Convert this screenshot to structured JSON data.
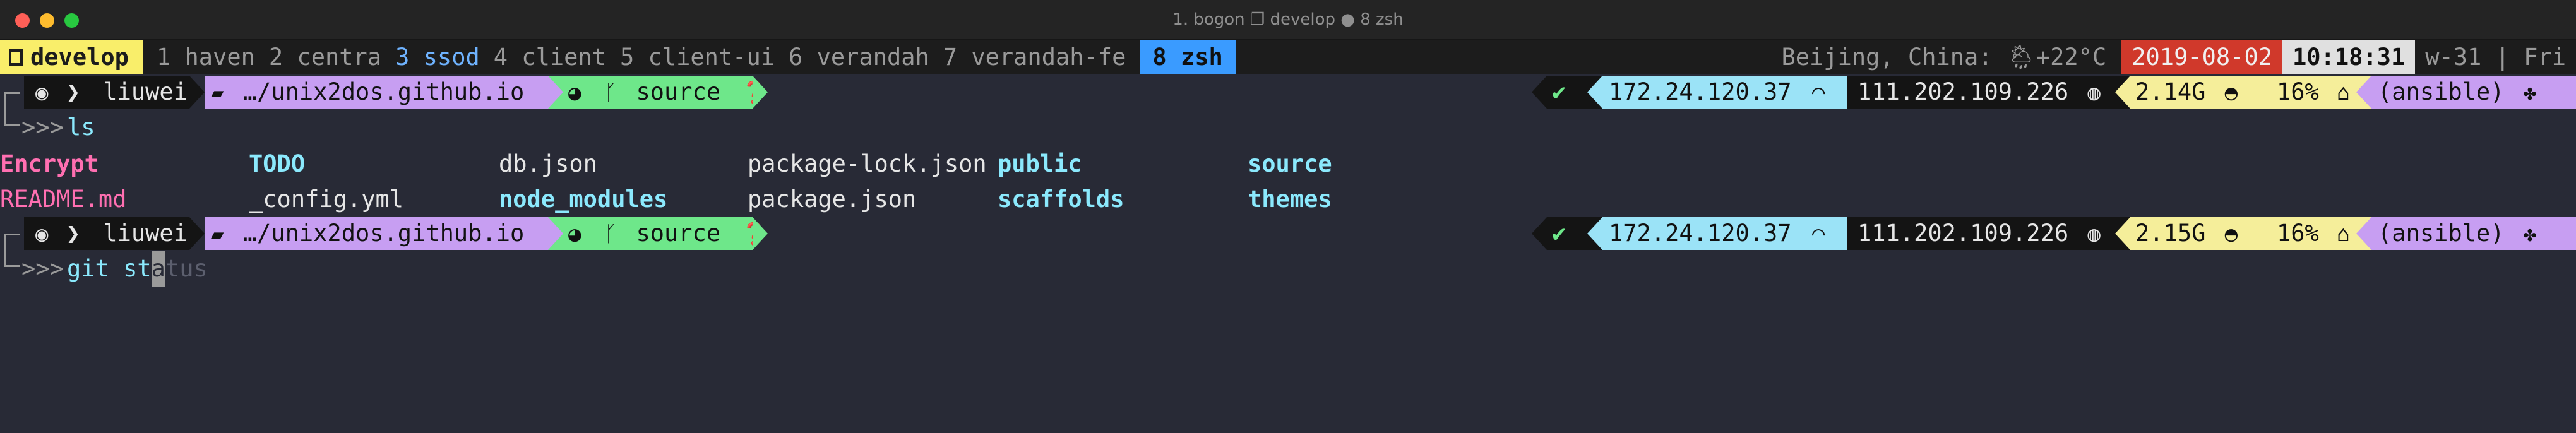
{
  "window": {
    "title": "1. bogon ❐ develop ● 8 zsh"
  },
  "tmux": {
    "session": "develop",
    "windows": [
      {
        "label": "1 haven",
        "state": "normal"
      },
      {
        "label": "2 centra",
        "state": "normal"
      },
      {
        "label": "3 ssod",
        "state": "bell"
      },
      {
        "label": "4 client",
        "state": "normal"
      },
      {
        "label": "5 client-ui",
        "state": "normal"
      },
      {
        "label": "6 verandah",
        "state": "normal"
      },
      {
        "label": "7 verandah-fe",
        "state": "normal"
      }
    ],
    "active_window": "8 zsh",
    "weather": "Beijing, China: 🌦+22°C",
    "date": "2019-08-02",
    "time": "10:18:31",
    "week": "w-31 | Fri"
  },
  "prompt": {
    "user": "liuwei",
    "path": "…/unix2dos.github.io",
    "branch": "source",
    "status_ok": "✔",
    "local_ip": "172.24.120.37",
    "public_ip": "111.202.109.226",
    "python_env": "(ansible)",
    "prompt_chars": ">>>"
  },
  "prompt1": {
    "memory": "2.14G",
    "disk": "16%",
    "command": "ls"
  },
  "prompt2": {
    "memory": "2.15G",
    "disk": "16%",
    "command_typed": "git st",
    "cursor_char": "a",
    "autosuggest": "tus"
  },
  "ls_output": [
    {
      "name": "Encrypt",
      "kind": "dir-magenta"
    },
    {
      "name": "TODO",
      "kind": "dir"
    },
    {
      "name": "db.json",
      "kind": "file"
    },
    {
      "name": "package-lock.json",
      "kind": "file"
    },
    {
      "name": "public",
      "kind": "dir"
    },
    {
      "name": "source",
      "kind": "dir"
    },
    {
      "name": "README.md",
      "kind": "file-pink"
    },
    {
      "name": "_config.yml",
      "kind": "file"
    },
    {
      "name": "node_modules",
      "kind": "dir"
    },
    {
      "name": "package.json",
      "kind": "file"
    },
    {
      "name": "scaffolds",
      "kind": "dir"
    },
    {
      "name": "themes",
      "kind": "dir"
    }
  ],
  "icons": {
    "apple": "apple-icon",
    "folder": "folder-open-icon",
    "github": "github-icon",
    "branch": "git-branch-icon",
    "question": "question-circle-icon",
    "wifi": "wifi-icon",
    "globe": "globe-icon",
    "gauge": "gauge-icon",
    "disk": "hard-drive-icon",
    "python": "python-icon"
  },
  "colors": {
    "background": "#282a36",
    "session": "#f9ee6a",
    "active_window": "#3a9bff",
    "date_bg": "#d0392b",
    "path_bg": "#c79ef2",
    "git_bg": "#6ee78a",
    "ip_bg": "#9be3f7",
    "mem_bg": "#f5ee9a"
  }
}
